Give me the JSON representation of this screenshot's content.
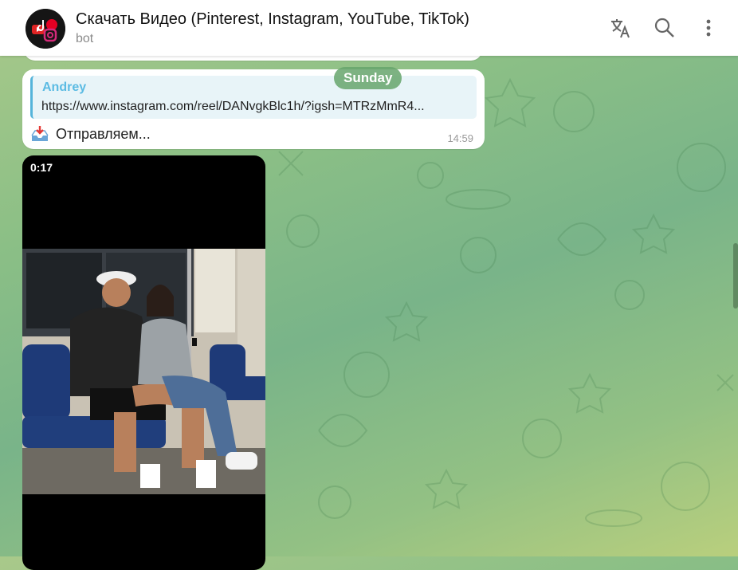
{
  "header": {
    "title": "Скачать Видео (Pinterest, Instagram, YouTube, TikTok)",
    "subtitle": "bot",
    "avatar_icon": "tiktok-pinterest-instagram-logos-icon",
    "actions": [
      "translate-icon",
      "search-icon",
      "more-vertical-icon"
    ]
  },
  "date_separator": "Sunday",
  "message": {
    "reply_author": "Andrey",
    "reply_text": "https://www.instagram.com/reel/DANvgkBlc1h/?igsh=MTRzMmR4...",
    "icon": "inbox-tray-icon",
    "text": "Отправляем...",
    "time": "14:59"
  },
  "video": {
    "duration": "0:17"
  },
  "colors": {
    "accent": "#5bbbe3",
    "pill": "#66a46c"
  }
}
